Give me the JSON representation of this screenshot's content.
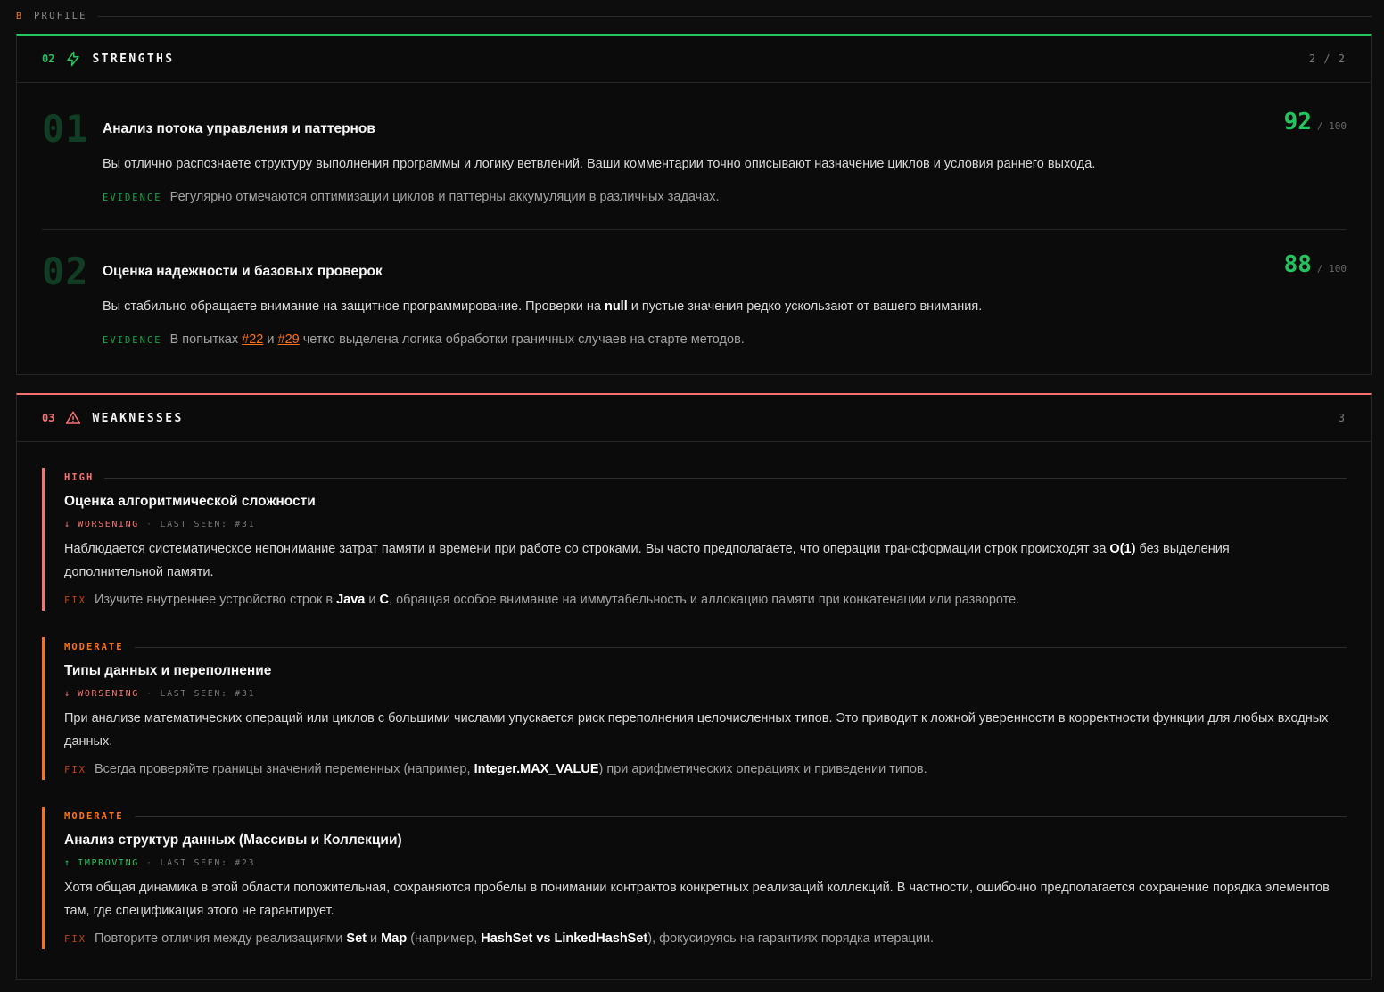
{
  "header": {
    "badge": "B",
    "title": "PROFILE"
  },
  "strengths": {
    "number": "02",
    "title": "STRENGTHS",
    "count": "2 / 2",
    "items": [
      {
        "index": "01",
        "title": "Анализ потока управления и паттернов",
        "score": "92",
        "score_max": "/ 100",
        "description": "Вы отлично распознаете структуру выполнения программы и логику ветвлений. Ваши комментарии точно описывают назначение циклов и условия раннего выхода.",
        "evidence_label": "EVIDENCE",
        "evidence": "Регулярно отмечаются оптимизации циклов и паттерны аккумуляции в различных задачах."
      },
      {
        "index": "02",
        "title": "Оценка надежности и базовых проверок",
        "score": "88",
        "score_max": "/ 100",
        "description_before": "Вы стабильно обращаете внимание на защитное программирование. Проверки на ",
        "description_highlight": "null",
        "description_after": " и пустые значения редко ускользают от вашего внимания.",
        "evidence_label": "EVIDENCE",
        "evidence_before": "В попытках ",
        "evidence_ref1": "#22",
        "evidence_mid": " и ",
        "evidence_ref2": "#29",
        "evidence_after": " четко выделена логика обработки граничных случаев на старте методов."
      }
    ]
  },
  "weaknesses": {
    "number": "03",
    "title": "WEAKNESSES",
    "count": "3",
    "items": [
      {
        "severity": "HIGH",
        "title": "Оценка алгоритмической сложности",
        "trend": "↓ WORSENING",
        "dot": "·",
        "last_seen": "LAST SEEN: #31",
        "desc_before": "Наблюдается систематическое непонимание затрат памяти и времени при работе со строками. Вы часто предполагаете, что операции трансформации строк происходят за ",
        "desc_hl": "O(1)",
        "desc_after": " без выделения дополнительной памяти.",
        "fix_label": "FIX",
        "fix_before": "Изучите внутреннее устройство строк в ",
        "fix_hl1": "Java",
        "fix_mid": " и ",
        "fix_hl2": "C",
        "fix_after": ", обращая особое внимание на иммутабельность и аллокацию памяти при конкатенации или развороте."
      },
      {
        "severity": "MODERATE",
        "title": "Типы данных и переполнение",
        "trend": "↓ WORSENING",
        "dot": "·",
        "last_seen": "LAST SEEN: #31",
        "desc": "При анализе математических операций или циклов с большими числами упускается риск переполнения целочисленных типов. Это приводит к ложной уверенности в корректности функции для любых входных данных.",
        "fix_label": "FIX",
        "fix_before": "Всегда проверяйте границы значений переменных (например, ",
        "fix_hl1": "Integer.MAX_VALUE",
        "fix_after": ") при арифметических операциях и приведении типов."
      },
      {
        "severity": "MODERATE",
        "title": "Анализ структур данных (Массивы и Коллекции)",
        "trend": "↑ IMPROVING",
        "dot": "·",
        "last_seen": "LAST SEEN: #23",
        "desc": "Хотя общая динамика в этой области положительная, сохраняются пробелы в понимании контрактов конкретных реализаций коллекций. В частности, ошибочно предполагается сохранение порядка элементов там, где спецификация этого не гарантирует.",
        "fix_label": "FIX",
        "fix_before": "Повторите отличия между реализациями ",
        "fix_hl1": "Set",
        "fix_mid1": " и ",
        "fix_hl2": "Map",
        "fix_mid2": " (например, ",
        "fix_hl3": "HashSet vs LinkedHashSet",
        "fix_after": "), фокусируясь на гарантиях порядка итерации."
      }
    ]
  },
  "colors": {
    "background": "#0d0d0d",
    "strength_accent": "#22c55e",
    "weakness_accent": "#f87171",
    "moderate_accent": "#f97316"
  },
  "icons": {
    "strengths": "lightning-icon",
    "weaknesses": "warning-triangle-icon"
  }
}
